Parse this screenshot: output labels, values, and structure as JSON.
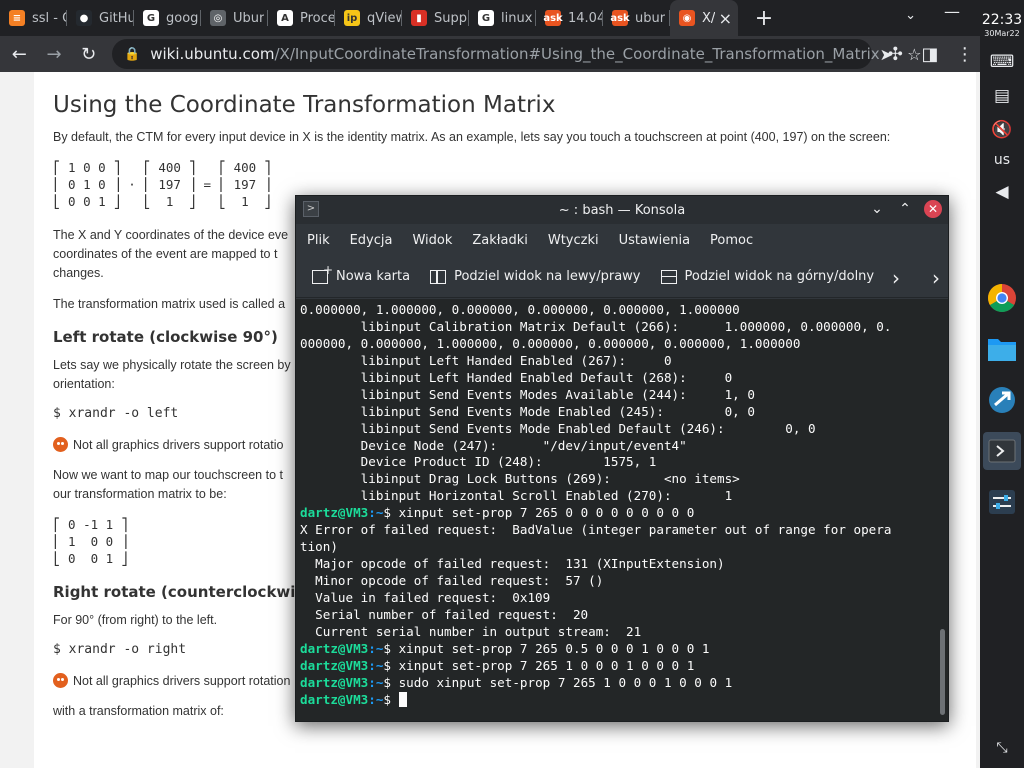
{
  "browser": {
    "tabs": [
      {
        "title": "ssl - C",
        "icon": "stackoverflow-icon",
        "color": "#f48024",
        "glyph": "≡"
      },
      {
        "title": "GitHu",
        "icon": "github-icon",
        "color": "#24292f",
        "glyph": "●"
      },
      {
        "title": "goog",
        "icon": "google-icon",
        "color": "#ffffff",
        "glyph": "G"
      },
      {
        "title": "Ubur",
        "icon": "globe-icon",
        "color": "#5f6368",
        "glyph": "◎"
      },
      {
        "title": "Proce",
        "icon": "letter-a-icon",
        "color": "#ffffff",
        "glyph": "A"
      },
      {
        "title": "qView",
        "icon": "iplocation-icon",
        "color": "#f5c518",
        "glyph": "ip"
      },
      {
        "title": "Supp",
        "icon": "shield-icon",
        "color": "#d93025",
        "glyph": "▮"
      },
      {
        "title": "linux",
        "icon": "google-icon",
        "color": "#ffffff",
        "glyph": "G"
      },
      {
        "title": "14.04",
        "icon": "askubuntu-icon",
        "color": "#e95420",
        "glyph": "ask"
      },
      {
        "title": "ubur",
        "icon": "askubuntu-icon",
        "color": "#e95420",
        "glyph": "ask"
      },
      {
        "title": "X/",
        "icon": "ubuntu-icon",
        "color": "#e95420",
        "glyph": "◉",
        "active": true
      }
    ],
    "url_host": "wiki.ubuntu.com",
    "url_path": "/X/InputCoordinateTransformation#Using_the_Coordinate_Transformation_Matrix"
  },
  "page": {
    "title": "Using the Coordinate Transformation Matrix",
    "intro": "By default, the CTM for every input device in X is the identity matrix. As an example, lets say you touch a touchscreen at point (400, 197) on the screen:",
    "identity_matrix": "⎡ 1 0 0 ⎤   ⎡ 400 ⎤   ⎡ 400 ⎤\n⎢ 0 1 0 ⎥ · ⎢ 197 ⎥ = ⎢ 197 ⎥\n⎣ 0 0 1 ⎦   ⎣  1  ⎦   ⎣  1  ⎦",
    "para_xy": "The X and Y coordinates of the device eve",
    "para_xy2": "coordinates of the event are mapped to t",
    "para_xy3": "changes.",
    "para_called": "The transformation matrix used is called a",
    "h_left": "Left rotate (clockwise 90°)",
    "para_left": "Lets say we physically rotate the screen by",
    "para_left2": "orientation:",
    "code_left": "$ xrandr -o left",
    "warn_text": "Not all graphics drivers support rotatio",
    "para_map": "Now we want to map our touchscreen to t",
    "para_map2": "our transformation matrix to be:",
    "left_matrix": "⎡ 0 -1 1 ⎤\n⎢ 1  0 0 ⎥\n⎣ 0  0 1 ⎦",
    "h_right": "Right rotate (counterclockwise 9",
    "para_right": "For 90° (from right) to the left.",
    "code_right": "$ xrandr -o right",
    "warn_text2": "Not all graphics drivers support rotation",
    "para_with": "with a transformation matrix of:"
  },
  "konsole": {
    "title": "~ : bash — Konsola",
    "menu": [
      "Plik",
      "Edycja",
      "Widok",
      "Zakładki",
      "Wtyczki",
      "Ustawienia",
      "Pomoc"
    ],
    "toolbar": [
      "Nowa karta",
      "Podziel widok na lewy/prawy",
      "Podziel widok na górny/dolny"
    ],
    "prompt_user": "dartz@VM3",
    "prompt_path": ":~",
    "lines": [
      {
        "t": "0.000000, 1.000000, 0.000000, 0.000000, 0.000000, 1.000000"
      },
      {
        "t": "        libinput Calibration Matrix Default (266):      1.000000, 0.000000, 0."
      },
      {
        "t": "000000, 0.000000, 1.000000, 0.000000, 0.000000, 0.000000, 1.000000"
      },
      {
        "t": "        libinput Left Handed Enabled (267):     0"
      },
      {
        "t": "        libinput Left Handed Enabled Default (268):     0"
      },
      {
        "t": "        libinput Send Events Modes Available (244):     1, 0"
      },
      {
        "t": "        libinput Send Events Mode Enabled (245):        0, 0"
      },
      {
        "t": "        libinput Send Events Mode Enabled Default (246):        0, 0"
      },
      {
        "t": "        Device Node (247):      \"/dev/input/event4\""
      },
      {
        "t": "        Device Product ID (248):        1575, 1"
      },
      {
        "t": "        libinput Drag Lock Buttons (269):       <no items>"
      },
      {
        "t": "        libinput Horizontal Scroll Enabled (270):       1"
      },
      {
        "cmd": "xinput set-prop 7 265 0 0 0 0 0 0 0 0 0"
      },
      {
        "t": "X Error of failed request:  BadValue (integer parameter out of range for opera"
      },
      {
        "t": "tion)"
      },
      {
        "t": "  Major opcode of failed request:  131 (XInputExtension)"
      },
      {
        "t": "  Minor opcode of failed request:  57 ()"
      },
      {
        "t": "  Value in failed request:  0x109"
      },
      {
        "t": "  Serial number of failed request:  20"
      },
      {
        "t": "  Current serial number in output stream:  21"
      },
      {
        "cmd": "xinput set-prop 7 265 0.5 0 0 0 1 0 0 0 1"
      },
      {
        "cmd": "xinput set-prop 7 265 1 0 0 0 1 0 0 0 1"
      },
      {
        "cmd": "sudo xinput set-prop 7 265 1 0 0 0 1 0 0 0 1"
      },
      {
        "cmd": "",
        "cursor": true
      }
    ]
  },
  "dock": {
    "time": "22:33",
    "date": "30Mar22",
    "lang": "us"
  }
}
